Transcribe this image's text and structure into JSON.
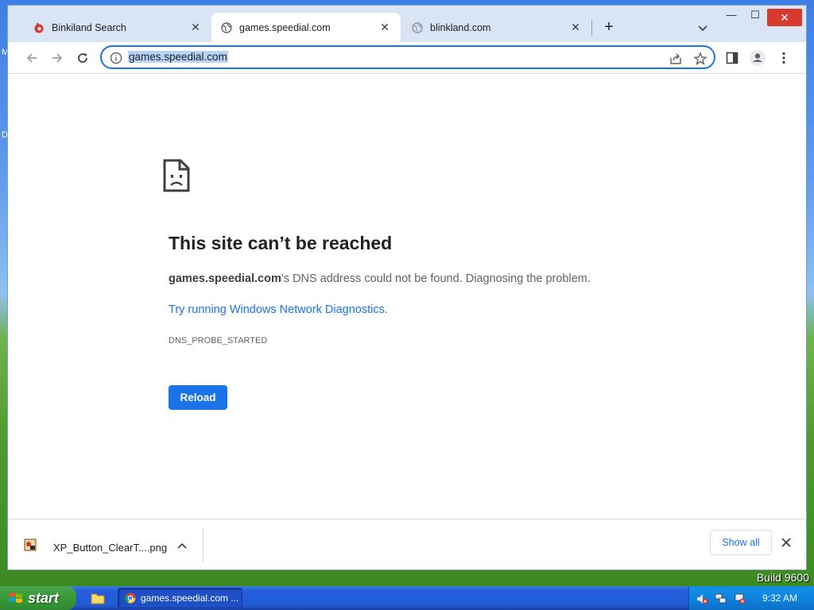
{
  "browser": {
    "tabs": [
      {
        "title": "Binkiland Search",
        "active": false
      },
      {
        "title": "games.speedial.com",
        "active": true
      },
      {
        "title": "blinkland.com",
        "active": false
      }
    ],
    "new_tab_symbol": "+",
    "address": "games.speedial.com",
    "window_controls": {
      "minimize": "—",
      "maximize": "☐",
      "close": "✕"
    }
  },
  "error_page": {
    "title": "This site can’t be reached",
    "host": "games.speedial.com",
    "description_rest": "’s DNS address could not be found. Diagnosing the problem.",
    "link": "Try running Windows Network Diagnostics.",
    "code": "DNS_PROBE_STARTED",
    "reload_label": "Reload"
  },
  "downloads": {
    "file_name": "XP_Button_ClearT....png",
    "show_all_label": "Show all"
  },
  "taskbar": {
    "start_label": "start",
    "task_label": "games.speedial.com ...",
    "clock": "9:32 AM"
  },
  "desktop": {
    "build_text": "Build 9600",
    "edge_letters": [
      "M",
      "D"
    ]
  },
  "colors": {
    "accent": "#1a73e8",
    "close_red": "#d83a2e",
    "taskbar_blue": "#245edb",
    "start_green": "#3b9b3b"
  },
  "icons": {
    "tab1": "binkiland-favicon",
    "tab2": "globe-icon",
    "tab3": "globe-icon",
    "back": "back-arrow-icon",
    "forward": "forward-arrow-icon",
    "reload": "reload-icon",
    "info": "info-icon",
    "share": "share-icon",
    "bookmark": "star-icon",
    "side_panel": "side-panel-icon",
    "profile": "profile-icon",
    "menu": "kebab-menu-icon"
  }
}
